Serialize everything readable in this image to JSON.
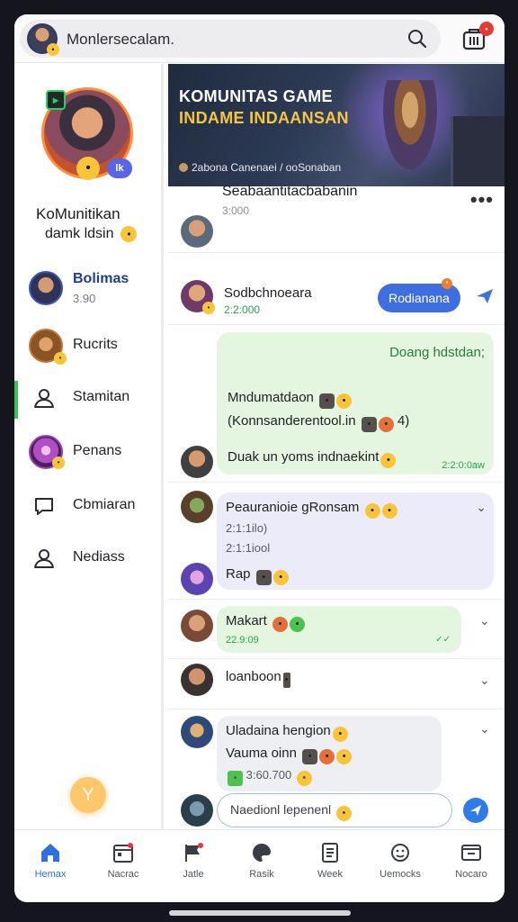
{
  "colors": {
    "accent": "#2f6fe0",
    "active_green": "#3ac257",
    "bubble_green": "#e4f6df",
    "bubble_lavender": "#ecebfa",
    "badge_red": "#e53935"
  },
  "topbar": {
    "search_text": "Monlersecalam.",
    "search_icon": "search-icon",
    "cart_icon": "store-icon",
    "cart_badge": "•"
  },
  "profile": {
    "tag": "▸",
    "level": "lk",
    "name": "KoMunitikan",
    "subtitle": "damk ldsin"
  },
  "sidebar": {
    "items": [
      {
        "label": "Bolimas",
        "sub": "3.90",
        "kind": "avatar"
      },
      {
        "label": "Rucrits",
        "kind": "avatar"
      },
      {
        "label": "Stamitan",
        "kind": "user-icon"
      },
      {
        "label": "Penans",
        "kind": "avatar"
      },
      {
        "label": "Cbmiaran",
        "kind": "chat-icon"
      },
      {
        "label": "Nediass",
        "kind": "user-icon"
      }
    ],
    "fab_label": "Y"
  },
  "banner": {
    "title_line1": "KOMUNITAS GAME",
    "title_line2": "INDAME INDAANSAN",
    "caption": "2abona Canenaei / ooSonaban"
  },
  "post": {
    "name": "Seabaantitacbabanin",
    "meta": "3:000",
    "more": "•••"
  },
  "messages": {
    "m1": {
      "name": "Sodbchnoeara",
      "time": "2:2:000",
      "button": "Rodianana",
      "button_badge": "•"
    },
    "m2": {
      "header": "Doang hdstdan;",
      "line1": "Mndumatdaon",
      "line2": "(Konnsanderentool.in",
      "line2_suffix": "4)",
      "line3": "Duak un yoms indnaekint",
      "time": "2:2:0:0aw"
    },
    "m3": {
      "line1": "Peauranioie gRonsam",
      "line2": "2:1:1ilo)",
      "line3": "2:1:1iool",
      "line4": "Rap"
    },
    "m4": {
      "name": "Makart",
      "time": "22.9:09",
      "check": "✓✓"
    },
    "m5": {
      "name": "loanboon"
    },
    "m6": {
      "line1": "Uladaina hengion",
      "line2": "Vauma oinn",
      "line3": "3:60.700"
    }
  },
  "composer": {
    "placeholder": "Naedionl lepenenl"
  },
  "bottom_nav": [
    {
      "label": "Hemax",
      "icon": "home-icon"
    },
    {
      "label": "Nacrac",
      "icon": "calendar-icon"
    },
    {
      "label": "Jatle",
      "icon": "flag-icon"
    },
    {
      "label": "Rasik",
      "icon": "palette-icon"
    },
    {
      "label": "Week",
      "icon": "document-icon"
    },
    {
      "label": "Uemocks",
      "icon": "emoji-icon"
    },
    {
      "label": "Nocaro",
      "icon": "tablet-icon"
    }
  ]
}
